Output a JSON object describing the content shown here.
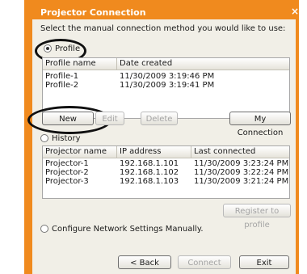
{
  "window": {
    "title": "Projector Connection",
    "close_glyph": "×"
  },
  "instruction": "Select the manual connection method you would like to use:",
  "profile": {
    "radio_label": "Profile",
    "columns": [
      "Profile name",
      "Date created"
    ],
    "rows": [
      [
        "Profile-1",
        "11/30/2009 3:19:46 PM"
      ],
      [
        "Profile-2",
        "11/30/2009 3:19:41 PM"
      ]
    ],
    "buttons": {
      "new": "New",
      "edit": "Edit",
      "delete": "Delete",
      "my_connection": "My Connection"
    }
  },
  "history": {
    "radio_label": "History",
    "columns": [
      "Projector name",
      "IP address",
      "Last connected"
    ],
    "rows": [
      [
        "Projector-1",
        "192.168.1.101",
        "11/30/2009 3:23:24 PM"
      ],
      [
        "Projector-2",
        "192.168.1.102",
        "11/30/2009 3:22:24 PM"
      ],
      [
        "Projector-3",
        "192.168.1.103",
        "11/30/2009 3:21:24 PM"
      ]
    ],
    "register_button": "Register to profile"
  },
  "manual": {
    "radio_label": "Configure Network Settings Manually."
  },
  "footer": {
    "back": "< Back",
    "connect": "Connect",
    "exit": "Exit"
  },
  "colors": {
    "frame": "#f08a1e",
    "dialog_bg": "#f1efe7",
    "highlight_ring": "#111111"
  }
}
